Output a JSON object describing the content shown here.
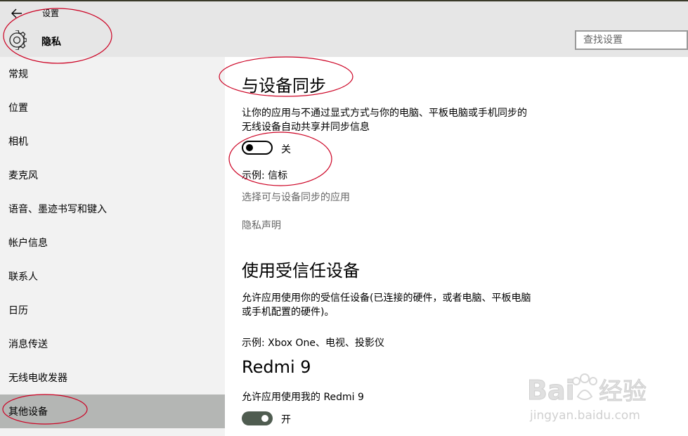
{
  "header": {
    "app_title": "设置",
    "page_title": "隐私",
    "search": {
      "placeholder": "查找设置"
    }
  },
  "sidebar": {
    "items": [
      {
        "label": "常规"
      },
      {
        "label": "位置"
      },
      {
        "label": "相机"
      },
      {
        "label": "麦克风"
      },
      {
        "label": "语音、墨迹书写和键入"
      },
      {
        "label": "帐户信息"
      },
      {
        "label": "联系人"
      },
      {
        "label": "日历"
      },
      {
        "label": "消息传送"
      },
      {
        "label": "无线电收发器"
      },
      {
        "label": "其他设备",
        "selected": true
      }
    ]
  },
  "sync_section": {
    "title": "与设备同步",
    "description_line1": "让你的应用与不通过显式方式与你的电脑、平板电脑或手机同步的",
    "description_line2": "无线设备自动共享并同步信息",
    "toggle_state": "关",
    "example": "示例: 信标",
    "choose_apps_link": "选择可与设备同步的应用",
    "privacy_link": "隐私声明"
  },
  "trusted_section": {
    "title": "使用受信任设备",
    "description_line1": "允许应用使用你的受信任设备(已连接的硬件，或者电脑、平板电脑",
    "description_line2": "或手机配置的硬件)。",
    "example": "示例: Xbox One、电视、投影仪"
  },
  "device": {
    "name": "Redmi 9",
    "allow_label": "允许应用使用我的 Redmi 9",
    "toggle_state": "开"
  },
  "colors": {
    "annotation": "#cc0022",
    "selected_nav": "#b4b6b4",
    "toggle_on": "#4f5c50"
  },
  "watermark": {
    "brand": "Baidu经验",
    "url": "jingyan.baidu.com"
  }
}
